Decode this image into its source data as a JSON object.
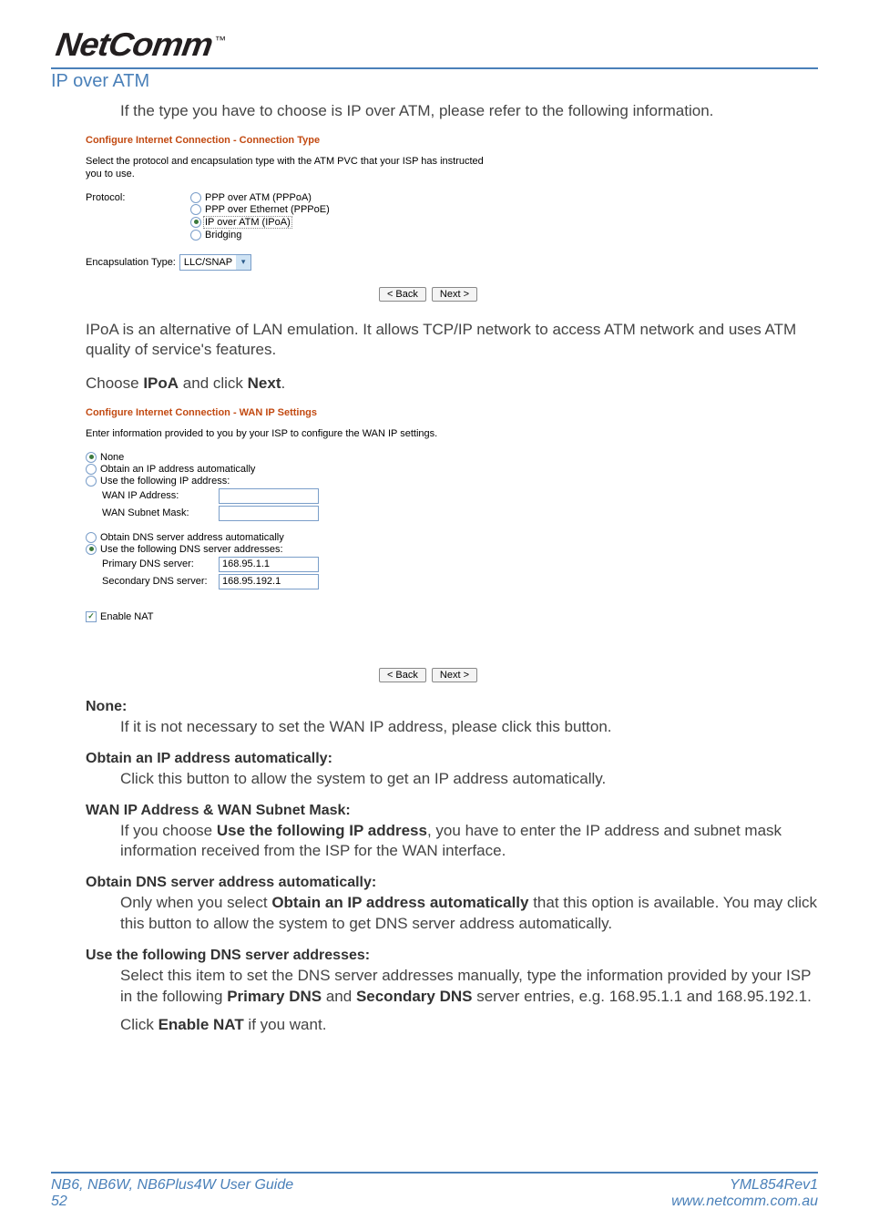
{
  "brand": {
    "name": "NetComm",
    "tm": "™"
  },
  "section_title": "IP over ATM",
  "intro": "If the type you have to choose is IP over ATM, please refer to the following information.",
  "screenshot1": {
    "title": "Configure Internet Connection - Connection Type",
    "sub": "Select the protocol and encapsulation type with the ATM PVC that your ISP has instructed you to use.",
    "protocol_label": "Protocol:",
    "protocols": [
      {
        "label": "PPP over ATM (PPPoA)",
        "checked": false
      },
      {
        "label": "PPP over Ethernet (PPPoE)",
        "checked": false
      },
      {
        "label": "IP over ATM (IPoA)",
        "checked": true
      },
      {
        "label": "Bridging",
        "checked": false
      }
    ],
    "encaps_label": "Encapsulation Type:",
    "encaps_value": "LLC/SNAP",
    "back": "< Back",
    "next": "Next >"
  },
  "para_ipoa": "IPoA is an alternative of LAN emulation. It allows TCP/IP network to access ATM network and uses ATM quality of service's features.",
  "choose_line": {
    "pre": "Choose ",
    "b1": "IPoA",
    "mid": " and click ",
    "b2": "Next",
    "post": "."
  },
  "screenshot2": {
    "title": "Configure Internet Connection - WAN IP Settings",
    "sub": "Enter information provided to you by your ISP to configure the WAN IP settings.",
    "opts": [
      {
        "label": "None",
        "checked": true
      },
      {
        "label": "Obtain an IP address automatically",
        "checked": false
      },
      {
        "label": "Use the following IP address:",
        "checked": false
      }
    ],
    "wan_ip_label": "WAN IP Address:",
    "wan_ip_value": "",
    "wan_mask_label": "WAN Subnet Mask:",
    "wan_mask_value": "",
    "dns_opts": [
      {
        "label": "Obtain DNS server address automatically",
        "checked": false
      },
      {
        "label": "Use the following DNS server addresses:",
        "checked": true
      }
    ],
    "primary_dns_label": "Primary DNS server:",
    "primary_dns_value": "168.95.1.1",
    "secondary_dns_label": "Secondary DNS server:",
    "secondary_dns_value": "168.95.192.1",
    "enable_nat": "Enable NAT",
    "back": "< Back",
    "next": "Next >"
  },
  "defs": {
    "none": {
      "t": "None:",
      "d": "If it is not necessary to set the WAN IP address, please click this button."
    },
    "obtain_ip": {
      "t": "Obtain an IP address automatically:",
      "d": "Click this button to allow the system to get an IP address automatically."
    },
    "wan": {
      "t": "WAN IP Address & WAN Subnet Mask:",
      "d_pre": "If you choose ",
      "d_b": "Use the following IP address",
      "d_post": ", you have to enter the IP address and subnet mask information received from the ISP for the WAN interface."
    },
    "obtain_dns": {
      "t": "Obtain DNS server address automatically:",
      "d_pre": "Only when you select ",
      "d_b": "Obtain an IP address automatically",
      "d_post": " that this option is available. You may click this button to allow the system to get DNS server address automatically."
    },
    "use_dns": {
      "t": "Use the following DNS server addresses:",
      "d1_pre": "Select this item to set the DNS server addresses manually, type the information provided by your ISP in the following ",
      "d1_b1": "Primary DNS",
      "d1_mid": " and ",
      "d1_b2": "Secondary DNS",
      "d1_post": " server entries, e.g. 168.95.1.1 and 168.95.192.1.",
      "d2_pre": "Click ",
      "d2_b": "Enable NAT",
      "d2_post": " if you want."
    }
  },
  "footer": {
    "guide": "NB6, NB6W, NB6Plus4W User Guide",
    "page": "52",
    "rev": "YML854Rev1",
    "url": "www.netcomm.com.au"
  }
}
